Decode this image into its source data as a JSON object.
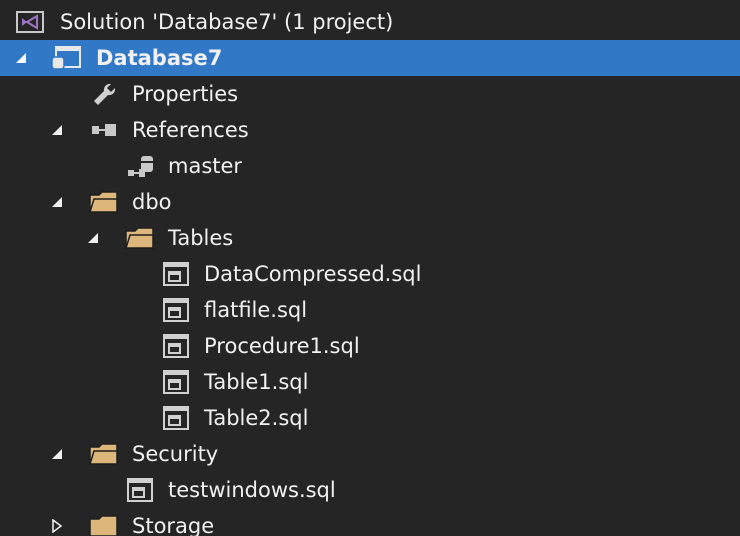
{
  "solution_explorer": {
    "solution": {
      "label": "Solution 'Database7' (1 project)",
      "icon": "visual-studio-solution-icon"
    },
    "project": {
      "label": "Database7",
      "icon": "database-project-icon",
      "expanded": true,
      "selected": true,
      "selection_color": "#3178c6"
    },
    "properties": {
      "label": "Properties",
      "icon": "wrench-icon"
    },
    "references": {
      "label": "References",
      "icon": "references-icon",
      "expanded": true,
      "items": [
        {
          "label": "master",
          "icon": "database-reference-icon"
        }
      ]
    },
    "dbo": {
      "label": "dbo",
      "icon": "folder-icon",
      "expanded": true,
      "tables": {
        "label": "Tables",
        "icon": "folder-icon",
        "expanded": true,
        "items": [
          {
            "label": "DataCompressed.sql",
            "icon": "table-file-icon"
          },
          {
            "label": "flatfile.sql",
            "icon": "table-file-icon"
          },
          {
            "label": "Procedure1.sql",
            "icon": "table-file-icon"
          },
          {
            "label": "Table1.sql",
            "icon": "table-file-icon"
          },
          {
            "label": "Table2.sql",
            "icon": "table-file-icon"
          }
        ]
      }
    },
    "security": {
      "label": "Security",
      "icon": "folder-icon",
      "expanded": true,
      "items": [
        {
          "label": "testwindows.sql",
          "icon": "table-file-icon"
        }
      ]
    },
    "storage": {
      "label": "Storage",
      "icon": "folder-icon",
      "expanded": false
    }
  },
  "colors": {
    "background": "#252526",
    "text": "#f1f1f1",
    "selection": "#3178c6",
    "folder": "#dcb67a",
    "vs_purple": "#a074c4"
  }
}
